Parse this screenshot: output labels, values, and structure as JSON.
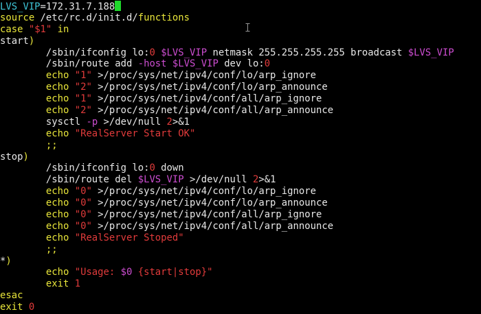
{
  "colors": {
    "background": "#000000",
    "default": "#e8e8e8",
    "cyan": "#3fc5d8",
    "yellow": "#e8e53a",
    "red": "#e23b3b",
    "magenta": "#cd4dd1",
    "cursor": "#1fd82b"
  },
  "editor": {
    "lines": [
      {
        "segments": [
          {
            "text": "LVS_VIP",
            "color": "cyan"
          },
          {
            "text": "=172.31.7.188",
            "color": "white"
          }
        ],
        "cursor": true
      },
      {
        "segments": [
          {
            "text": "source",
            "color": "yellow"
          },
          {
            "text": " /etc/rc.d/init.d/",
            "color": "white"
          },
          {
            "text": "functions",
            "color": "yellow"
          }
        ]
      },
      {
        "segments": [
          {
            "text": "case",
            "color": "yellow"
          },
          {
            "text": " ",
            "color": "white"
          },
          {
            "text": "\"$1\"",
            "color": "red"
          },
          {
            "text": " in",
            "color": "yellow"
          }
        ]
      },
      {
        "segments": [
          {
            "text": "start",
            "color": "white"
          },
          {
            "text": ")",
            "color": "yellow"
          }
        ]
      },
      {
        "segments": [
          {
            "text": "        /sbin/ifconfig lo:",
            "color": "white"
          },
          {
            "text": "0",
            "color": "red"
          },
          {
            "text": " ",
            "color": "white"
          },
          {
            "text": "$LVS_VIP",
            "color": "magenta"
          },
          {
            "text": " netmask 255.255.255.255 broadcast ",
            "color": "white"
          },
          {
            "text": "$LVS_VIP",
            "color": "magenta"
          }
        ]
      },
      {
        "segments": [
          {
            "text": "        /sbin/route add ",
            "color": "white"
          },
          {
            "text": "-host",
            "color": "magenta"
          },
          {
            "text": " ",
            "color": "white"
          },
          {
            "text": "$LVS_VIP",
            "color": "magenta"
          },
          {
            "text": " dev lo:",
            "color": "white"
          },
          {
            "text": "0",
            "color": "red"
          }
        ]
      },
      {
        "segments": [
          {
            "text": "        echo ",
            "color": "yellow"
          },
          {
            "text": "\"1\"",
            "color": "red"
          },
          {
            "text": " >/proc/sys/net/ipv4/conf/lo/arp_ignore",
            "color": "white"
          }
        ]
      },
      {
        "segments": [
          {
            "text": "        echo ",
            "color": "yellow"
          },
          {
            "text": "\"2\"",
            "color": "red"
          },
          {
            "text": " >/proc/sys/net/ipv4/conf/lo/arp_announce",
            "color": "white"
          }
        ]
      },
      {
        "segments": [
          {
            "text": "        echo ",
            "color": "yellow"
          },
          {
            "text": "\"1\"",
            "color": "red"
          },
          {
            "text": " >/proc/sys/net/ipv4/conf/all/arp_ignore",
            "color": "white"
          }
        ]
      },
      {
        "segments": [
          {
            "text": "        echo ",
            "color": "yellow"
          },
          {
            "text": "\"2\"",
            "color": "red"
          },
          {
            "text": " >/proc/sys/net/ipv4/conf/all/arp_announce",
            "color": "white"
          }
        ]
      },
      {
        "segments": [
          {
            "text": "        sysctl ",
            "color": "white"
          },
          {
            "text": "-p",
            "color": "magenta"
          },
          {
            "text": " >/dev/null ",
            "color": "white"
          },
          {
            "text": "2",
            "color": "red"
          },
          {
            "text": ">&1",
            "color": "white"
          }
        ]
      },
      {
        "segments": [
          {
            "text": "        echo ",
            "color": "yellow"
          },
          {
            "text": "\"RealServer Start OK\"",
            "color": "red"
          }
        ]
      },
      {
        "segments": [
          {
            "text": "        ;;",
            "color": "yellow"
          }
        ]
      },
      {
        "segments": [
          {
            "text": "stop",
            "color": "white"
          },
          {
            "text": ")",
            "color": "yellow"
          }
        ]
      },
      {
        "segments": [
          {
            "text": "        /sbin/ifconfig lo:",
            "color": "white"
          },
          {
            "text": "0",
            "color": "red"
          },
          {
            "text": " down",
            "color": "white"
          }
        ]
      },
      {
        "segments": [
          {
            "text": "        /sbin/route del ",
            "color": "white"
          },
          {
            "text": "$LVS_VIP",
            "color": "magenta"
          },
          {
            "text": " >/dev/null ",
            "color": "white"
          },
          {
            "text": "2",
            "color": "red"
          },
          {
            "text": ">&1",
            "color": "white"
          }
        ]
      },
      {
        "segments": [
          {
            "text": "        echo ",
            "color": "yellow"
          },
          {
            "text": "\"0\"",
            "color": "red"
          },
          {
            "text": " >/proc/sys/net/ipv4/conf/lo/arp_ignore",
            "color": "white"
          }
        ]
      },
      {
        "segments": [
          {
            "text": "        echo ",
            "color": "yellow"
          },
          {
            "text": "\"0\"",
            "color": "red"
          },
          {
            "text": " >/proc/sys/net/ipv4/conf/lo/arp_announce",
            "color": "white"
          }
        ]
      },
      {
        "segments": [
          {
            "text": "        echo ",
            "color": "yellow"
          },
          {
            "text": "\"0\"",
            "color": "red"
          },
          {
            "text": " >/proc/sys/net/ipv4/conf/all/arp_ignore",
            "color": "white"
          }
        ]
      },
      {
        "segments": [
          {
            "text": "        echo ",
            "color": "yellow"
          },
          {
            "text": "\"0\"",
            "color": "red"
          },
          {
            "text": " >/proc/sys/net/ipv4/conf/all/arp_announce",
            "color": "white"
          }
        ]
      },
      {
        "segments": [
          {
            "text": "        echo ",
            "color": "yellow"
          },
          {
            "text": "\"RealServer Stoped\"",
            "color": "red"
          }
        ]
      },
      {
        "segments": [
          {
            "text": "        ;;",
            "color": "yellow"
          }
        ]
      },
      {
        "segments": [
          {
            "text": "*",
            "color": "white"
          },
          {
            "text": ")",
            "color": "yellow"
          }
        ]
      },
      {
        "segments": [
          {
            "text": "        echo ",
            "color": "yellow"
          },
          {
            "text": "\"Usage: ",
            "color": "red"
          },
          {
            "text": "$0",
            "color": "magenta"
          },
          {
            "text": " {start|stop}\"",
            "color": "red"
          }
        ]
      },
      {
        "segments": [
          {
            "text": "        exit ",
            "color": "yellow"
          },
          {
            "text": "1",
            "color": "red"
          }
        ]
      },
      {
        "segments": [
          {
            "text": "esac",
            "color": "yellow"
          }
        ]
      },
      {
        "segments": [
          {
            "text": "exit ",
            "color": "yellow"
          },
          {
            "text": "0",
            "color": "red"
          }
        ]
      }
    ]
  },
  "pointer": {
    "icon": "text-ibeam-cursor-icon"
  }
}
